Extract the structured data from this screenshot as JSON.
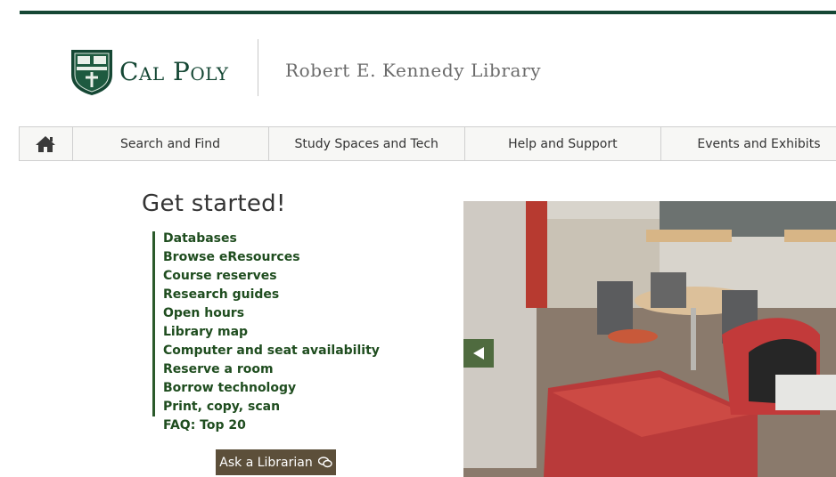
{
  "header": {
    "logo_text": "Cal Poly",
    "library_name": "Robert E. Kennedy Library"
  },
  "nav": {
    "home_icon": "home-icon",
    "items": [
      {
        "label": "Search and Find"
      },
      {
        "label": "Study Spaces and Tech"
      },
      {
        "label": "Help and Support"
      },
      {
        "label": "Events and Exhibits"
      }
    ]
  },
  "get_started": {
    "title": "Get started!",
    "links": [
      "Databases",
      "Browse eResources",
      "Course reserves",
      "Research guides",
      "Open hours",
      "Library map",
      "Computer and seat availability",
      "Reserve a room",
      "Borrow technology",
      "Print, copy, scan",
      "FAQ: Top 20"
    ],
    "ask_button": "Ask a Librarian",
    "ask_icon": "chat-icon"
  },
  "carousel": {
    "prev_icon": "arrow-left-icon"
  },
  "colors": {
    "brand_green": "#154734",
    "link_green": "#1f4d1f",
    "button_brown": "#5c4f3a"
  }
}
